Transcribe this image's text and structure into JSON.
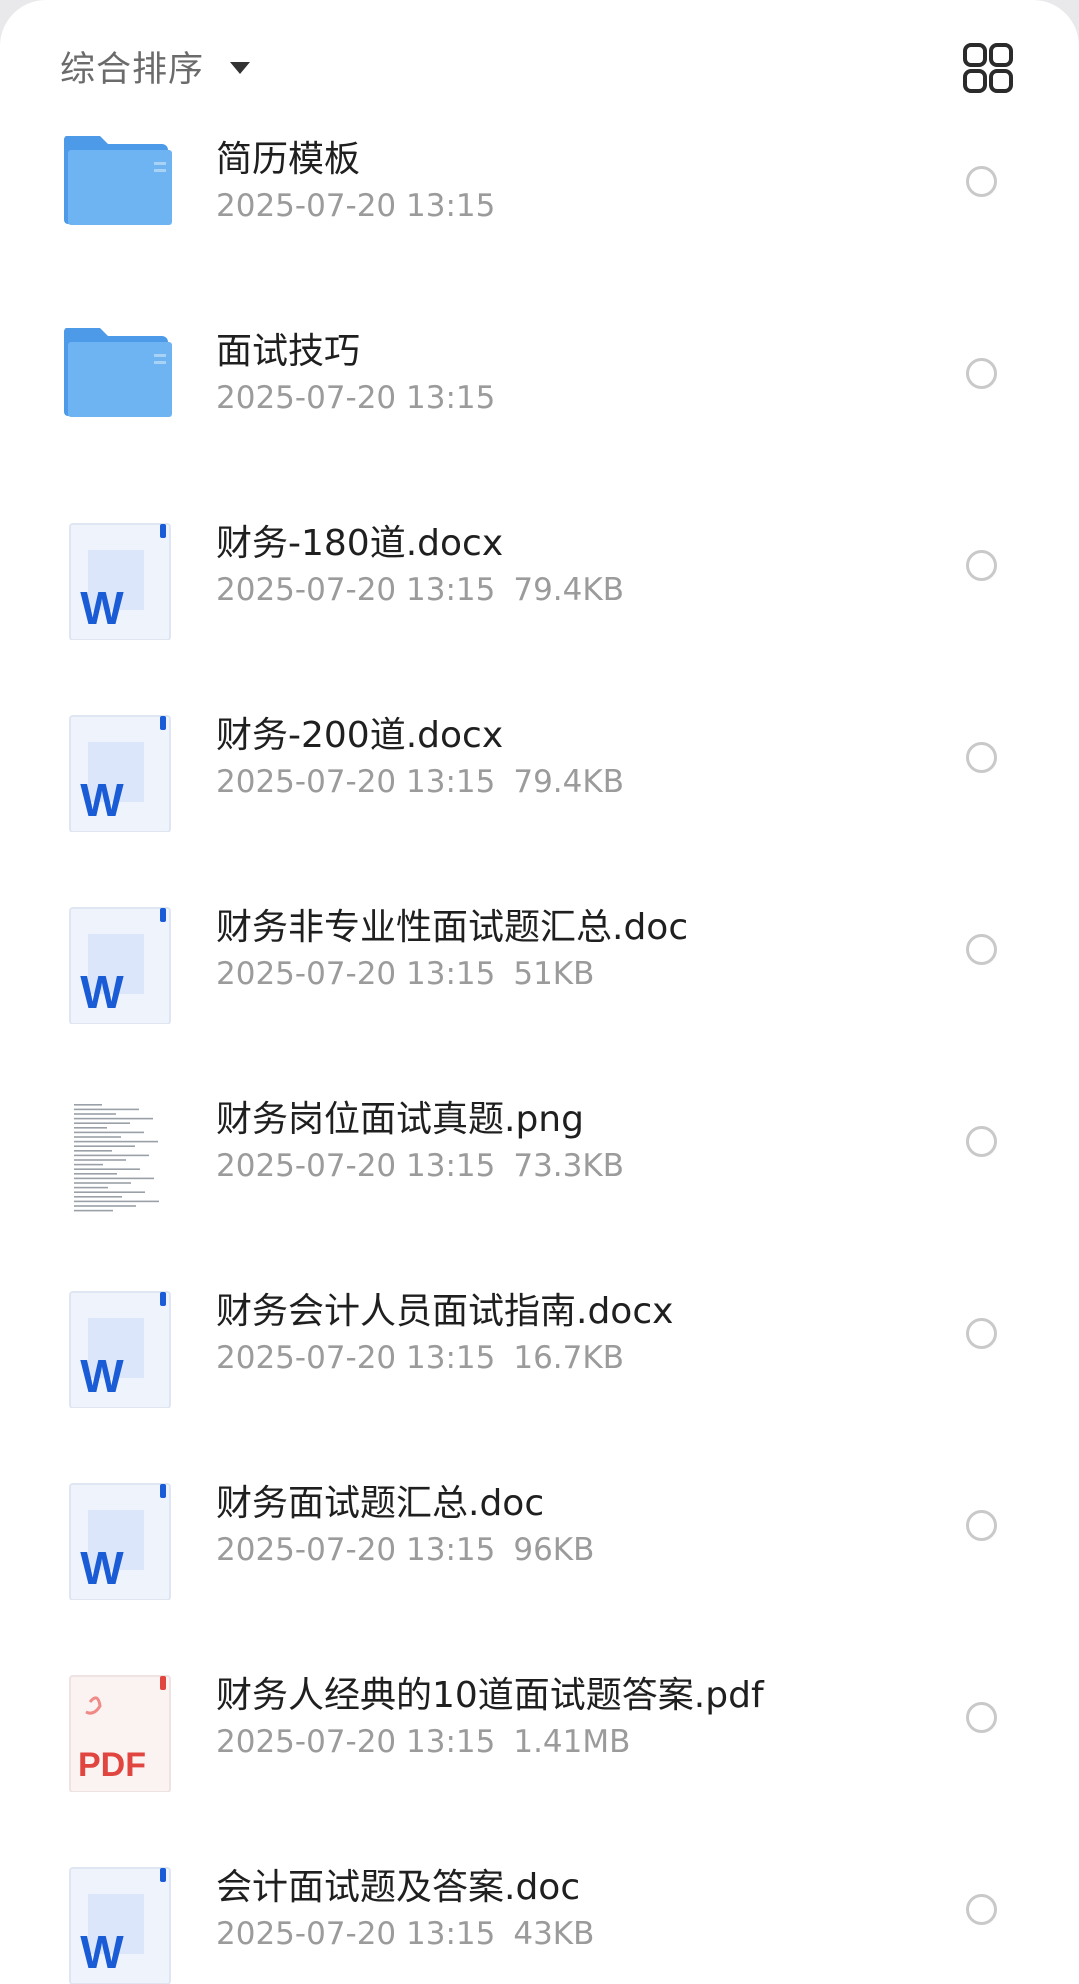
{
  "toolbar": {
    "sort_label": "综合排序",
    "sort_icon": "caret-down-icon",
    "view_toggle_icon": "grid-view-icon"
  },
  "colors": {
    "folder_blue": "#6fb4f2",
    "word_blue": "#1a5bd6",
    "pdf_red": "#e0453f",
    "meta_gray": "#9b9b9b",
    "title_text": "#1f1f1f"
  },
  "files": [
    {
      "name": "简历模板",
      "date": "2025-07-20 13:15",
      "size": "",
      "type": "folder",
      "icon": "folder-icon"
    },
    {
      "name": "面试技巧",
      "date": "2025-07-20 13:15",
      "size": "",
      "type": "folder",
      "icon": "folder-icon"
    },
    {
      "name": "财务-180道.docx",
      "date": "2025-07-20 13:15",
      "size": "79.4KB",
      "type": "word",
      "icon": "word-doc-icon"
    },
    {
      "name": "财务-200道.docx",
      "date": "2025-07-20 13:15",
      "size": "79.4KB",
      "type": "word",
      "icon": "word-doc-icon"
    },
    {
      "name": "财务非专业性面试题汇总.doc",
      "date": "2025-07-20 13:15",
      "size": "51KB",
      "type": "word",
      "icon": "word-doc-icon"
    },
    {
      "name": "财务岗位面试真题.png",
      "date": "2025-07-20 13:15",
      "size": "73.3KB",
      "type": "image",
      "icon": "image-thumbnail-icon"
    },
    {
      "name": "财务会计人员面试指南.docx",
      "date": "2025-07-20 13:15",
      "size": "16.7KB",
      "type": "word",
      "icon": "word-doc-icon"
    },
    {
      "name": "财务面试题汇总.doc",
      "date": "2025-07-20 13:15",
      "size": "96KB",
      "type": "word",
      "icon": "word-doc-icon"
    },
    {
      "name": "财务人经典的10道面试题答案.pdf",
      "date": "2025-07-20 13:15",
      "size": "1.41MB",
      "type": "pdf",
      "icon": "pdf-doc-icon",
      "badge": "PDF"
    },
    {
      "name": "会计面试题及答案.doc",
      "date": "2025-07-20 13:15",
      "size": "43KB",
      "type": "word",
      "icon": "word-doc-icon"
    }
  ]
}
